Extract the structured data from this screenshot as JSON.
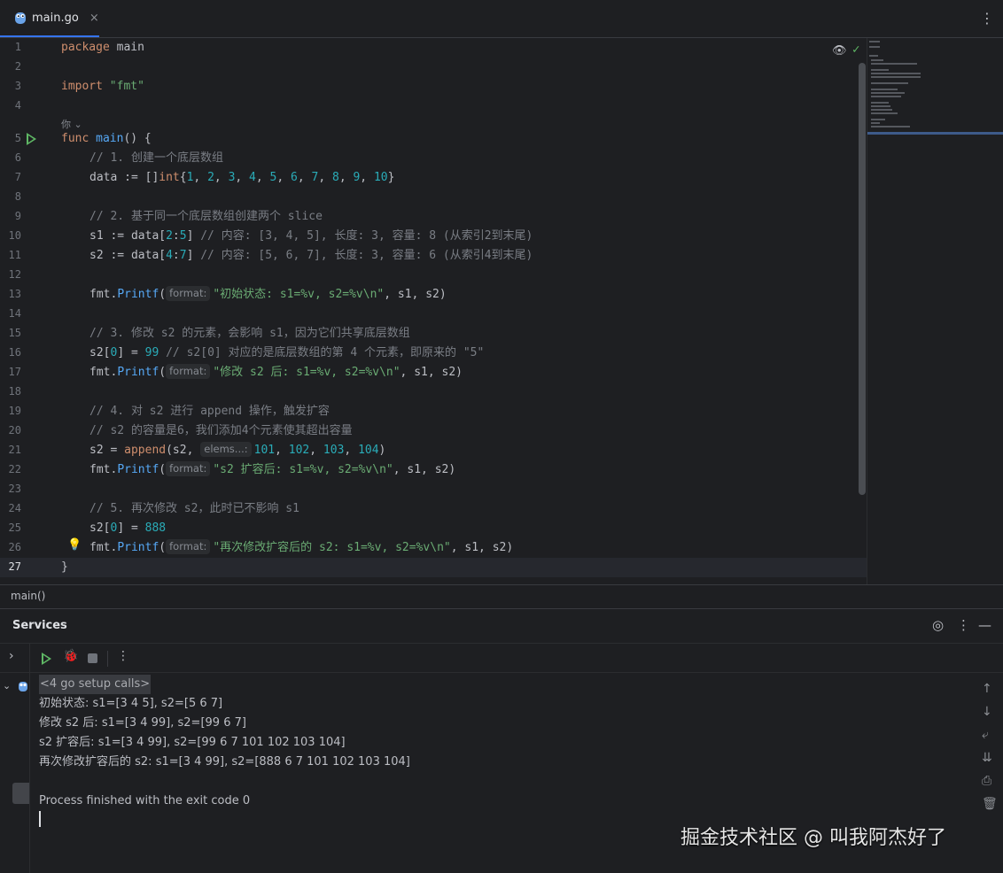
{
  "tab": {
    "file_name": "main.go",
    "close_glyph": "×",
    "menu_glyph": "⋮"
  },
  "editor": {
    "line_numbers": [
      "1",
      "2",
      "3",
      "4",
      "5",
      "6",
      "7",
      "8",
      "9",
      "10",
      "11",
      "12",
      "13",
      "14",
      "15",
      "16",
      "17",
      "18",
      "19",
      "20",
      "21",
      "22",
      "23",
      "24",
      "25",
      "26",
      "27"
    ],
    "author_hint": "你 ⌄",
    "hints": {
      "format": "format:",
      "elems": "elems...:"
    },
    "code": {
      "l1a": "package",
      "l1b": " main",
      "l3a": "import",
      "l3b": "\"fmt\"",
      "l5a": "func",
      "l5b": "main",
      "l5c": "() {",
      "l6": "// 1. 创建一个底层数组",
      "l7a": "data := []",
      "l7b": "int",
      "l7c": "{",
      "l7n1": "1",
      "l7n2": "2",
      "l7n3": "3",
      "l7n4": "4",
      "l7n5": "5",
      "l7n6": "6",
      "l7n7": "7",
      "l7n8": "8",
      "l7n9": "9",
      "l7n10": "10",
      "l7d": "}",
      "l9": "// 2. 基于同一个底层数组创建两个 slice",
      "l10a": "s1 := data[",
      "l10b": "2",
      "l10c": ":",
      "l10d": "5",
      "l10e": "] ",
      "l10f": "// 内容: [3, 4, 5], 长度: 3, 容量: 8 (从索引2到末尾)",
      "l11a": "s2 := data[",
      "l11b": "4",
      "l11c": ":",
      "l11d": "7",
      "l11e": "] ",
      "l11f": "// 内容: [5, 6, 7], 长度: 3, 容量: 6 (从索引4到末尾)",
      "l13a": "fmt.",
      "l13b": "Printf",
      "l13c": "(",
      "l13d": "\"初始状态: s1=%v, s2=%v\\n\"",
      "l13e": ", s1, s2)",
      "l15": "// 3. 修改 s2 的元素，会影响 s1，因为它们共享底层数组",
      "l16a": "s2[",
      "l16b": "0",
      "l16c": "] = ",
      "l16d": "99",
      "l16e": " // s2[0] 对应的是底层数组的第 4 个元素，即原来的 \"5\"",
      "l17a": "fmt.",
      "l17b": "Printf",
      "l17c": "(",
      "l17d": "\"修改 s2 后: s1=%v, s2=%v\\n\"",
      "l17e": ", s1, s2)",
      "l19": "// 4. 对 s2 进行 append 操作，触发扩容",
      "l20": "// s2 的容量是6，我们添加4个元素使其超出容量",
      "l21a": "s2 = ",
      "l21b": "append",
      "l21c": "(s2, ",
      "l21d": "101",
      "l21e": ", ",
      "l21f": "102",
      "l21g": ", ",
      "l21h": "103",
      "l21i": ", ",
      "l21j": "104",
      "l21k": ")",
      "l22a": "fmt.",
      "l22b": "Printf",
      "l22c": "(",
      "l22d": "\"s2 扩容后: s1=%v, s2=%v\\n\"",
      "l22e": ", s1, s2)",
      "l24": "// 5. 再次修改 s2，此时已不影响 s1",
      "l25a": "s2[",
      "l25b": "0",
      "l25c": "] = ",
      "l25d": "888",
      "l26a": "fmt.",
      "l26b": "Printf",
      "l26c": "(",
      "l26d": "\"再次修改扩容后的 s2: s1=%v, s2=%v\\n\"",
      "l26e": ", s1, s2)",
      "l27": "}"
    }
  },
  "breadcrumb": {
    "label": "main()"
  },
  "services": {
    "title": "Services",
    "console_lines": [
      "<4 go setup calls>",
      "初始状态: s1=[3 4 5], s2=[5 6 7]",
      "修改 s2 后: s1=[3 4 99], s2=[99 6 7]",
      "s2 扩容后: s1=[3 4 99], s2=[99 6 7 101 102 103 104]",
      "再次修改扩容后的 s2: s1=[3 4 99], s2=[888 6 7 101 102 103 104]",
      "Process finished with the exit code 0"
    ]
  },
  "watermark": "掘金技术社区 @ 叫我阿杰好了",
  "colors": {
    "keyword": "#cf8e6d",
    "string": "#6aab73",
    "number": "#2aacb8",
    "comment": "#7a7e85",
    "function": "#56a8f5",
    "run_green": "#5fb865",
    "accent": "#3574f0"
  },
  "icons": [
    "gopher-file-icon",
    "close-icon",
    "more-menu-icon",
    "run-gutter-icon",
    "lightbulb-icon",
    "reader-mode-icon",
    "check-icon",
    "target-icon",
    "minimize-icon",
    "run-icon",
    "debug-icon",
    "stop-icon",
    "scroll-up-icon",
    "scroll-down-icon",
    "soft-wrap-icon",
    "scroll-to-end-icon",
    "print-icon",
    "trash-icon"
  ]
}
